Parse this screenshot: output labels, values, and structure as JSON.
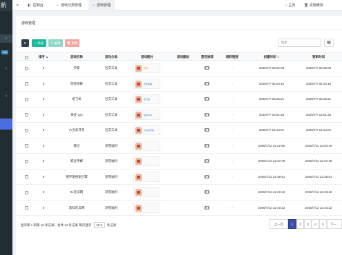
{
  "sidebar": {
    "logo": "航",
    "search_icon": "search-icon",
    "badge": "hot",
    "arrow": "‹"
  },
  "topnav": {
    "menu_icon": "≡",
    "tabs": [
      {
        "label": "控制台",
        "icon": "dashboard-icon"
      },
      {
        "label": "游戏分类管理",
        "icon": "circle-icon"
      },
      {
        "label": "游戏管理",
        "icon": "circle-icon"
      }
    ],
    "home_label": "主页",
    "clear_cache_label": "清除缓存"
  },
  "panel": {
    "title": "游戏管理",
    "add_label": "添加",
    "edit_label": "编辑",
    "delete_label": "删除",
    "search_placeholder": "搜索"
  },
  "table": {
    "headers": {
      "sort": "排序",
      "name": "游戏名称",
      "category": "游戏分类",
      "image": "游戏图片",
      "icon": "游戏图标",
      "recommend": "是否推荐",
      "link": "跳转链接",
      "created": "创建时间",
      "updated": "更新时间"
    },
    "rows": [
      {
        "sort": "0",
        "name": "币安",
        "category": "社交工具",
        "thumb_text": "币安",
        "thumb_color": "#d4a017",
        "link": "-",
        "created": "2025/7/7 05:22:03",
        "updated": "2025/7/7 05:25:00"
      },
      {
        "sort": "0",
        "name": "旺旺商聊",
        "category": "社交工具",
        "thumb_text": "旺旺商聊",
        "thumb_color": "#3a6fd8",
        "link": "-",
        "created": "2025/7/7 05:24:10",
        "updated": "2025/7/7 05:24:10"
      },
      {
        "sort": "0",
        "name": "纸飞机",
        "category": "社交工具",
        "thumb_text": "纸飞机",
        "thumb_color": "#3a6fd8",
        "link": "-",
        "created": "2025/7/7 05:26:21",
        "updated": "2025/7/7 05:26:21"
      },
      {
        "sort": "0",
        "name": "快连 vpn",
        "category": "社交工具",
        "thumb_text": "快连VPN",
        "thumb_color": "#3a6fd8",
        "link": "-",
        "created": "2025/7/7 16:01:26",
        "updated": "2025/7/7 16:01:26"
      },
      {
        "sort": "0",
        "name": "六合彩开奖",
        "category": "社交工具",
        "thumb_text": "六合彩开奖",
        "thumb_color": "#3a6fd8",
        "link": "-",
        "created": "2025/7/7 16:14:01",
        "updated": "2025/7/7 16:14:01"
      },
      {
        "sort": "0",
        "name": "麻豆",
        "category": "深夜福利",
        "thumb_text": "",
        "thumb_color": "#3a6fd8",
        "link": "-",
        "created": "2025/7/12 22:22:56",
        "updated": "2025/7/12 23:04:19"
      },
      {
        "sort": "0",
        "name": "麻豆传媒",
        "category": "深夜福利",
        "thumb_text": "",
        "thumb_color": "#3a6fd8",
        "link": "-",
        "created": "2025/7/12 22:37:49",
        "updated": "2025/7/12 22:37:49"
      },
      {
        "sort": "0",
        "name": "俄罗斯搜索引擎",
        "category": "深夜福利",
        "thumb_text": "",
        "thumb_color": "#3a6fd8",
        "link": "-",
        "created": "2025/7/12 22:39:51",
        "updated": "2025/7/12 22:39:51"
      },
      {
        "sort": "0",
        "name": "91吃瓜网",
        "category": "深夜福利",
        "thumb_text": "",
        "thumb_color": "#3a6fd8",
        "link": "-",
        "created": "2025/7/12 22:40:10",
        "updated": "2025/7/12 22:40:10"
      },
      {
        "sort": "0",
        "name": "黑料吃瓜网",
        "category": "深夜福利",
        "thumb_text": "",
        "thumb_color": "#3a6fd8",
        "link": "-",
        "created": "2025/7/12 22:40:32",
        "updated": "2025/7/12 22:40:32"
      }
    ]
  },
  "footer": {
    "summary": "显示第 1 到第 10 条记录，总共 44 条记录 每页显示",
    "page_size": "10",
    "suffix": "条记录",
    "prev_label": "上一页",
    "pages": [
      "1",
      "2",
      "3",
      "4",
      "5"
    ],
    "next_label": "下一",
    "current_page": "1"
  },
  "colors": {
    "sidebar_bg": "#222d32",
    "accent": "#4a6ce0",
    "add": "#18bc9c",
    "edit": "#8ed6c6",
    "delete": "#f4a5a0"
  }
}
